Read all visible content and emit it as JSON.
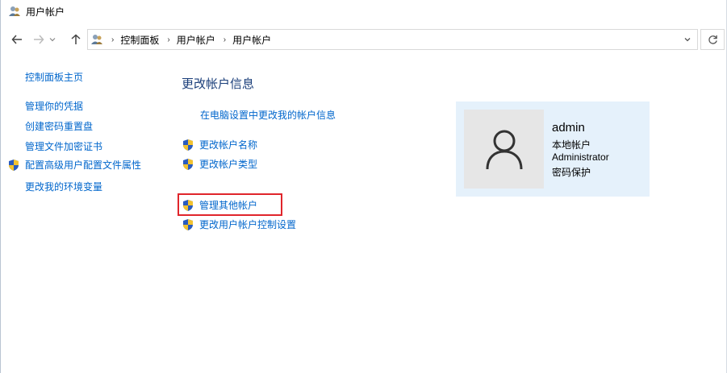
{
  "window": {
    "title": "用户帐户"
  },
  "address": {
    "breadcrumbs": [
      "控制面板",
      "用户帐户",
      "用户帐户"
    ]
  },
  "leftnav": {
    "home": "控制面板主页",
    "tasks": [
      "管理你的凭据",
      "创建密码重置盘",
      "管理文件加密证书"
    ],
    "shield_task": "配置高级用户配置文件属性",
    "env_task": "更改我的环境变量"
  },
  "main": {
    "heading": "更改帐户信息",
    "pc_settings_link": "在电脑设置中更改我的帐户信息",
    "change_name": "更改帐户名称",
    "change_type": "更改帐户类型",
    "manage_other": "管理其他帐户",
    "uac_settings": "更改用户帐户控制设置"
  },
  "account": {
    "name": "admin",
    "type": "本地帐户",
    "group": "Administrator",
    "password": "密码保护"
  },
  "colors": {
    "link": "#0066cc",
    "heading": "#1a3e7a",
    "card_bg": "#e5f1fb",
    "highlight": "#e0252b"
  }
}
